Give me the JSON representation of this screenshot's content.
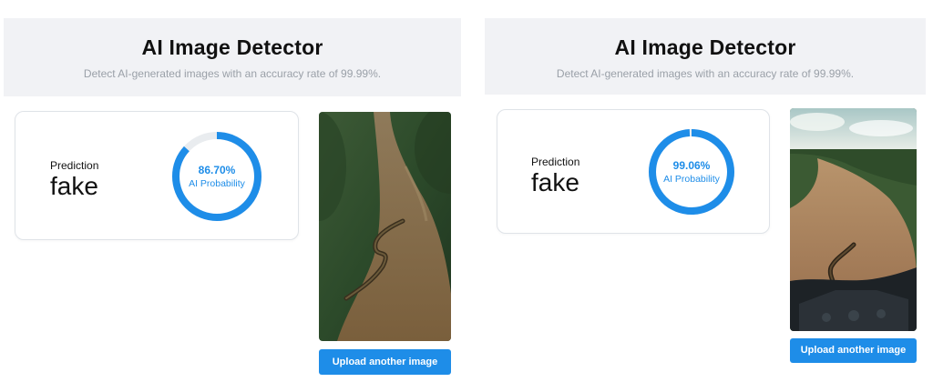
{
  "colors": {
    "accent": "#1e8de8",
    "gauge_track": "#e9ecef",
    "header_bg": "#f1f2f5",
    "subtitle": "#9aa0a8"
  },
  "left": {
    "title": "AI Image Detector",
    "subtitle": "Detect AI-generated images with an accuracy rate of 99.99%.",
    "prediction_label": "Prediction",
    "prediction_value": "fake",
    "probability": 86.7,
    "probability_text": "86.70%",
    "probability_label": "AI Probability",
    "image": "aerial-river-anaconda",
    "upload_label": "Upload another image"
  },
  "right": {
    "title": "AI Image Detector",
    "subtitle": "Detect AI-generated images with an accuracy rate of 99.99%.",
    "prediction_label": "Prediction",
    "prediction_value": "fake",
    "probability": 99.06,
    "probability_text": "99.06%",
    "probability_label": "AI Probability",
    "image": "helicopter-view-river-anaconda",
    "upload_label": "Upload another image"
  }
}
